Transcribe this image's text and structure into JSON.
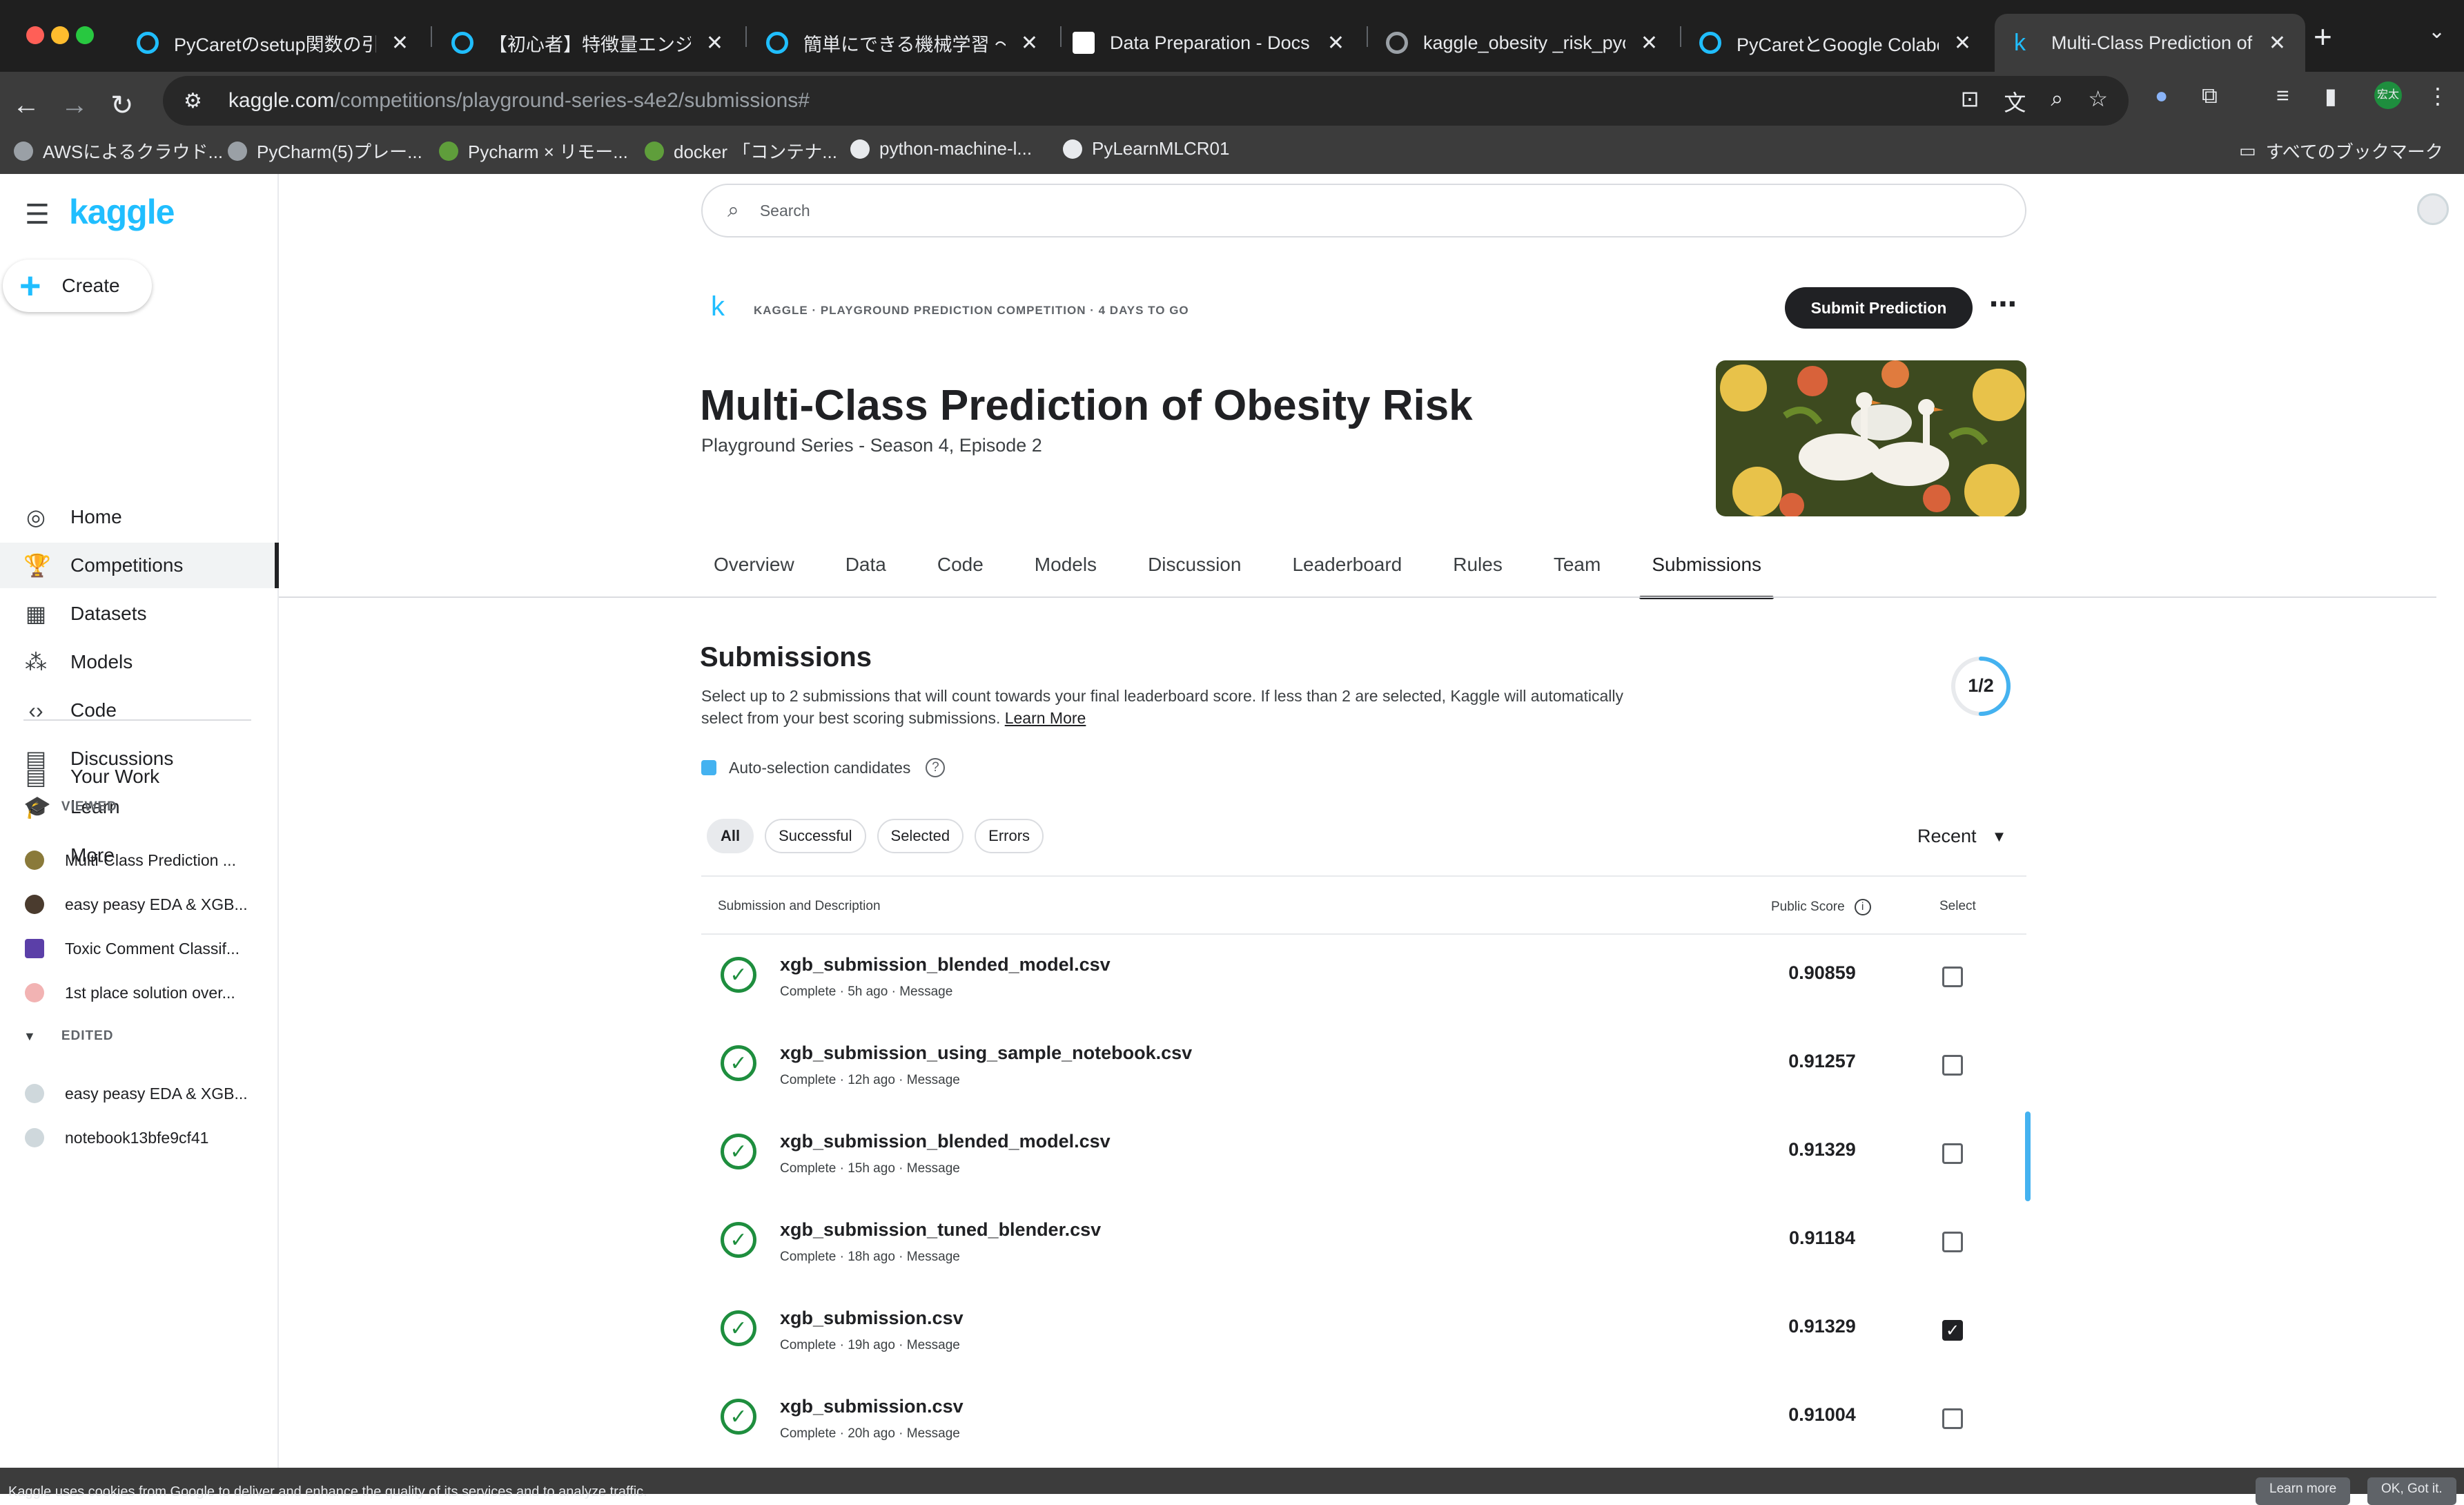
{
  "browser": {
    "tabs": [
      {
        "label": "PyCaretのsetup関数の引数に",
        "active": false
      },
      {
        "label": "【初心者】特徴量エンジニアリ",
        "active": false
      },
      {
        "label": "簡単にできる機械学習 〜PyCa",
        "active": false
      },
      {
        "label": "Data Preparation - Docs",
        "active": false
      },
      {
        "label": "kaggle_obesity _risk_pycar",
        "active": false
      },
      {
        "label": "PyCaretとGoogle Colaborat",
        "active": false
      },
      {
        "label": "Multi-Class Prediction of Ob",
        "active": true
      }
    ],
    "url_host": "kaggle.com",
    "url_path": "/competitions/playground-series-s4e2/submissions#",
    "bookmarks": [
      "AWSによるクラウド...",
      "PyCharm(5)プレー...",
      "Pycharm × リモー...",
      "docker 「コンテナ...",
      "python-machine-l...",
      "PyLearnMLCR01"
    ],
    "all_bookmarks": "すべてのブックマーク",
    "profile_badge": "宏太"
  },
  "sidebar": {
    "logo": "kaggle",
    "create_label": "Create",
    "nav": [
      {
        "label": "Home",
        "icon": "compass-icon",
        "glyph": "◎"
      },
      {
        "label": "Competitions",
        "icon": "trophy-icon",
        "glyph": "🏆",
        "active": true
      },
      {
        "label": "Datasets",
        "icon": "table-icon",
        "glyph": "▦"
      },
      {
        "label": "Models",
        "icon": "models-icon",
        "glyph": "⁂"
      },
      {
        "label": "Code",
        "icon": "code-icon",
        "glyph": "‹›"
      },
      {
        "label": "Discussions",
        "icon": "discussion-icon",
        "glyph": "▤"
      },
      {
        "label": "Learn",
        "icon": "learn-icon",
        "glyph": "🎓"
      },
      {
        "label": "More",
        "icon": "chevron-down-icon",
        "glyph": "⌄"
      }
    ],
    "your_work": "Your Work",
    "viewed_header": "VIEWED",
    "viewed": [
      "Multi-Class Prediction ...",
      "easy peasy EDA & XGB...",
      "Toxic Comment Classif...",
      "1st place solution over..."
    ],
    "edited_header": "EDITED",
    "edited": [
      "easy peasy EDA & XGB...",
      "notebook13bfe9cf41"
    ]
  },
  "search": {
    "placeholder": "Search"
  },
  "competition": {
    "meta": "KAGGLE · PLAYGROUND PREDICTION COMPETITION · 4 DAYS TO GO",
    "submit_label": "Submit Prediction",
    "title": "Multi-Class Prediction of Obesity Risk",
    "subtitle": "Playground Series - Season 4, Episode 2",
    "tabs": [
      "Overview",
      "Data",
      "Code",
      "Models",
      "Discussion",
      "Leaderboard",
      "Rules",
      "Team",
      "Submissions"
    ],
    "active_tab": "Submissions"
  },
  "submissions": {
    "heading": "Submissions",
    "description": "Select up to 2 submissions that will count towards your final leaderboard score. If less than 2 are selected, Kaggle will automatically select from your best scoring submissions.",
    "learn_more": "Learn More",
    "selected_count": "1/2",
    "selected_fraction": 0.5,
    "auto_selection": "Auto-selection candidates",
    "filters": [
      "All",
      "Successful",
      "Selected",
      "Errors"
    ],
    "active_filter": "All",
    "sort": "Recent",
    "col_submission": "Submission and Description",
    "col_score": "Public Score",
    "col_select": "Select",
    "rows": [
      {
        "file": "xgb_submission_blended_model.csv",
        "meta": "Complete · 5h ago · Message",
        "score": "0.90859",
        "selected": false
      },
      {
        "file": "xgb_submission_using_sample_notebook.csv",
        "meta": "Complete · 12h ago · Message",
        "score": "0.91257",
        "selected": false
      },
      {
        "file": "xgb_submission_blended_model.csv",
        "meta": "Complete · 15h ago · Message",
        "score": "0.91329",
        "selected": false
      },
      {
        "file": "xgb_submission_tuned_blender.csv",
        "meta": "Complete · 18h ago · Message",
        "score": "0.91184",
        "selected": false
      },
      {
        "file": "xgb_submission.csv",
        "meta": "Complete · 19h ago · Message",
        "score": "0.91329",
        "selected": true
      },
      {
        "file": "xgb_submission.csv",
        "meta": "Complete · 20h ago · Message",
        "score": "0.91004",
        "selected": false
      }
    ]
  },
  "cookie": {
    "text": "Kaggle uses cookies from Google to deliver and enhance the quality of its services and to analyze traffic.",
    "learn_more": "Learn more",
    "ok": "OK, Got it."
  },
  "colors": {
    "accent": "#20beff",
    "success": "#1e8e3e",
    "dark": "#202124"
  }
}
